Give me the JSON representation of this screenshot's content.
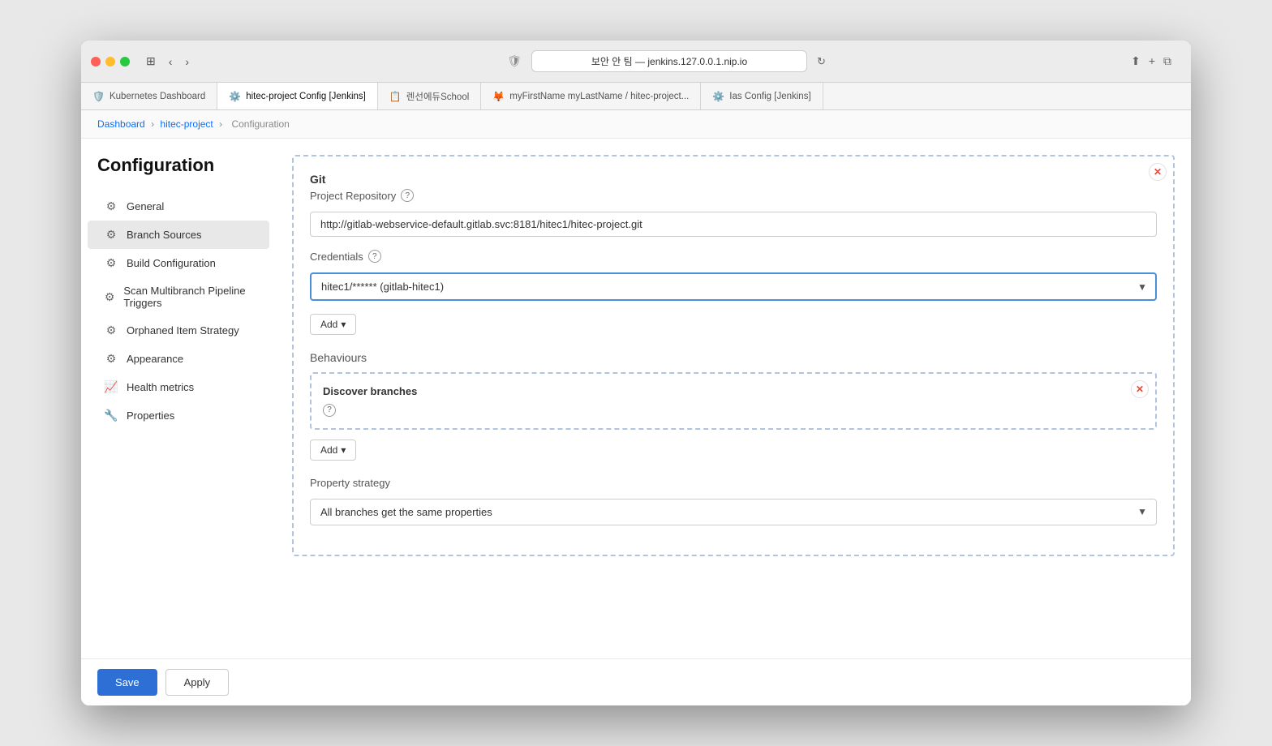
{
  "browser": {
    "url": "보안 안 팀 — jenkins.127.0.0.1.nip.io",
    "tabs": [
      {
        "id": "kubernetes",
        "label": "Kubernetes Dashboard",
        "icon": "🛡️",
        "icon_class": "blue",
        "active": false
      },
      {
        "id": "hitec-config",
        "label": "hitec-project Config [Jenkins]",
        "icon": "⚙️",
        "icon_class": "gray",
        "active": true
      },
      {
        "id": "school",
        "label": "렌선에듀School",
        "icon": "📋",
        "icon_class": "orange",
        "active": false
      },
      {
        "id": "myfirstname",
        "label": "myFirstName myLastName / hitec-project...",
        "icon": "🦊",
        "icon_class": "red",
        "active": false
      },
      {
        "id": "ias-config",
        "label": "Ias Config [Jenkins]",
        "icon": "⚙️",
        "icon_class": "gray",
        "active": false
      }
    ]
  },
  "breadcrumb": {
    "items": [
      "Dashboard",
      "hitec-project",
      "Configuration"
    ],
    "separator": "›"
  },
  "page": {
    "title": "Configuration"
  },
  "sidebar": {
    "items": [
      {
        "id": "general",
        "label": "General",
        "icon": "⚙️",
        "active": false
      },
      {
        "id": "branch-sources",
        "label": "Branch Sources",
        "icon": "⚙️",
        "active": true
      },
      {
        "id": "build-configuration",
        "label": "Build Configuration",
        "icon": "⚙️",
        "active": false
      },
      {
        "id": "scan-multibranch",
        "label": "Scan Multibranch Pipeline Triggers",
        "icon": "⚙️",
        "active": false
      },
      {
        "id": "orphaned-item",
        "label": "Orphaned Item Strategy",
        "icon": "⚙️",
        "active": false
      },
      {
        "id": "appearance",
        "label": "Appearance",
        "icon": "⚙️",
        "active": false
      },
      {
        "id": "health-metrics",
        "label": "Health metrics",
        "icon": "📈",
        "active": false
      },
      {
        "id": "properties",
        "label": "Properties",
        "icon": "🔧",
        "active": false
      }
    ]
  },
  "git_section": {
    "title": "Git",
    "project_repository_label": "Project Repository",
    "project_repository_help": "?",
    "project_repository_value": "http://gitlab-webservice-default.gitlab.svc:8181/hitec1/hitec-project.git",
    "credentials_label": "Credentials",
    "credentials_help": "?",
    "credentials_value": "hitec1/****** (gitlab-hitec1)",
    "add_button_label": "Add",
    "behaviours_label": "Behaviours",
    "discover_branches_title": "Discover branches",
    "add_button2_label": "Add",
    "property_strategy_label": "Property strategy",
    "property_strategy_value": "All branches get the same properties"
  },
  "footer": {
    "save_label": "Save",
    "apply_label": "Apply"
  }
}
